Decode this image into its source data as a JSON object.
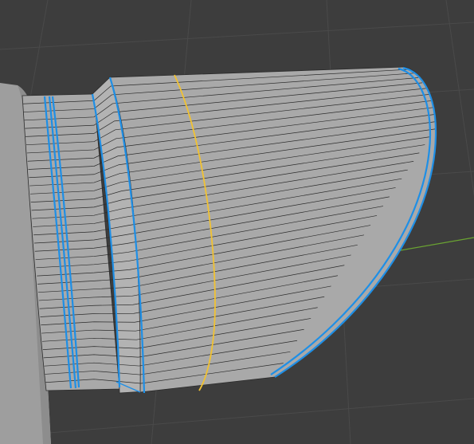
{
  "viewport": {
    "background": "#3d3d3d",
    "grid_color": "#4a4a4a",
    "x_axis_color": "#6aa332"
  },
  "mesh": {
    "face_color": "#a9a9a9",
    "edge_color": "#2b2b2b",
    "selected_edge_color": "#1e8fe6",
    "active_edge_color": "#f1c232",
    "side_object_color": "#9e9e9e"
  },
  "icons": {
    "grid": "viewport-grid-icon",
    "mesh": "mesh-object-icon"
  }
}
